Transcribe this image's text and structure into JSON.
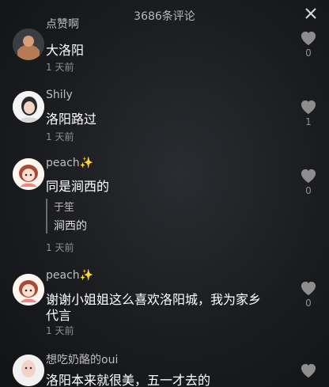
{
  "header": {
    "title": "3686条评论"
  },
  "comments": [
    {
      "username": "点赞啊",
      "text": "大洛阳",
      "time": "1 天前",
      "likes": "0"
    },
    {
      "username": "Shily",
      "text": "洛阳路过",
      "time": "1 天前",
      "likes": "1"
    },
    {
      "username": "peach✨",
      "text": "同是涧西的",
      "quote": {
        "author": "于笙",
        "text": "涧西的"
      },
      "time": "1 天前",
      "likes": "0"
    },
    {
      "username": "peach✨",
      "text_line1": "谢谢小姐姐这么喜欢洛阳城，我为家乡",
      "text_line2": "代言",
      "time": "1 天前",
      "likes": "0"
    },
    {
      "username": "想吃奶酪的oui",
      "text": "洛阳本来就很美，五一才去的"
    }
  ]
}
